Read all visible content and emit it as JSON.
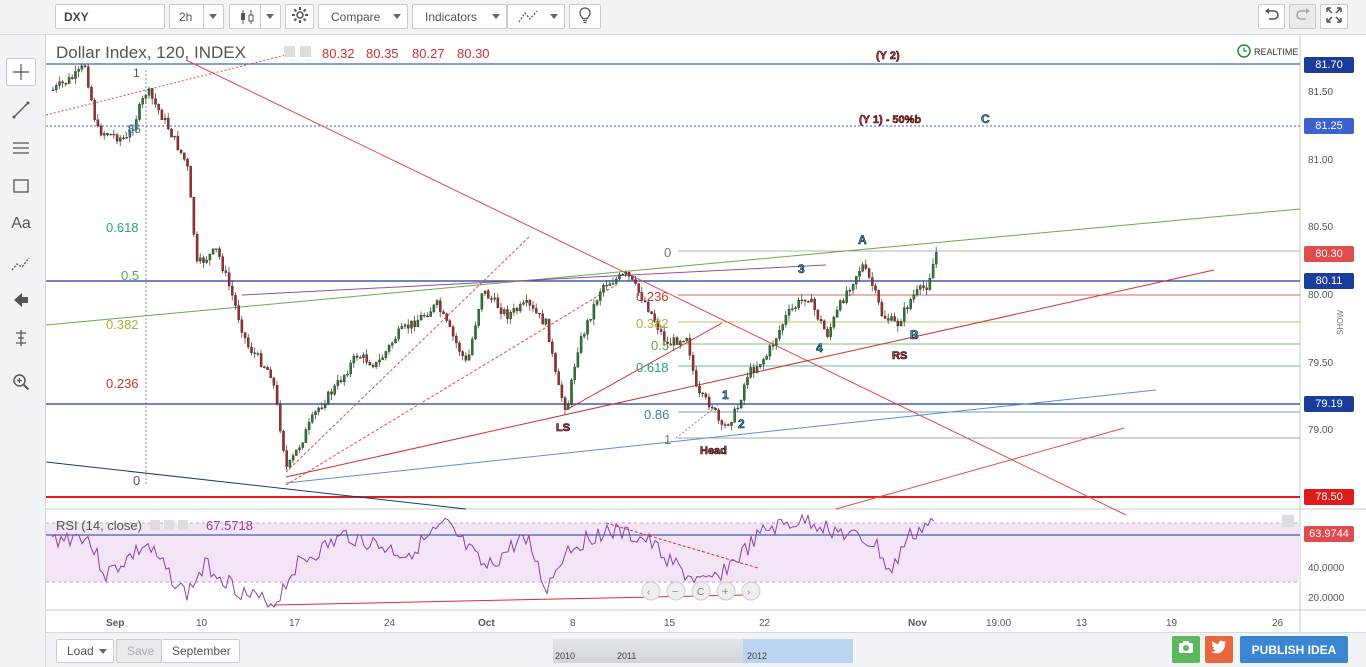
{
  "toolbar": {
    "symbol": "DXY",
    "interval": "2h",
    "compare_label": "Compare",
    "indicators_label": "Indicators"
  },
  "legend": {
    "title": "Dollar Index, 120, INDEX",
    "o": "80.32",
    "h": "80.35",
    "l": "80.27",
    "c": "80.30",
    "realtime": "REALTIME"
  },
  "price_axis": {
    "ticks": [
      "81.50",
      "81.00",
      "80.50",
      "80.00",
      "79.50",
      "79.00"
    ],
    "tags": [
      {
        "value": "81.70",
        "color": "#1a3c9c"
      },
      {
        "value": "81.25",
        "color": "#3a63d1"
      },
      {
        "value": "80.30",
        "color": "#e04b4b"
      },
      {
        "value": "80.11",
        "color": "#1a3c9c"
      },
      {
        "value": "79.19",
        "color": "#1a3c9c"
      },
      {
        "value": "78.50",
        "color": "#e01a1a"
      }
    ],
    "show_label": "SHOW"
  },
  "rsi": {
    "label": "RSI (14, close)",
    "value": "67.5718",
    "ticks": [
      "40.0000",
      "20.0000"
    ],
    "tag": "63.9744"
  },
  "time_axis": [
    "Sep",
    "10",
    "17",
    "24",
    "Oct",
    "8",
    "15",
    "22",
    "Nov",
    "19:00",
    "13",
    "19",
    "26"
  ],
  "fib_left": [
    "0.618",
    "0.5",
    "0.382",
    "0.236",
    "0"
  ],
  "fib_left_top": [
    "1",
    ".86"
  ],
  "fib_mid": [
    "0",
    "0.236",
    "0.382",
    "0.5",
    "0.618",
    "0.86",
    "1"
  ],
  "annotations": {
    "ls": "LS",
    "head": "Head",
    "rs": "RS",
    "w1": "1",
    "w2": "2",
    "w3": "3",
    "w4": "4",
    "a": "A",
    "b": "B",
    "c": "C",
    "y2": "(Y 2)",
    "y1": "(Y 1) - 50%b"
  },
  "bottom": {
    "load": "Load",
    "save": "Save",
    "layout": "September",
    "publish": "PUBLISH IDEA",
    "years": [
      "2010",
      "2011",
      "2012"
    ]
  }
}
